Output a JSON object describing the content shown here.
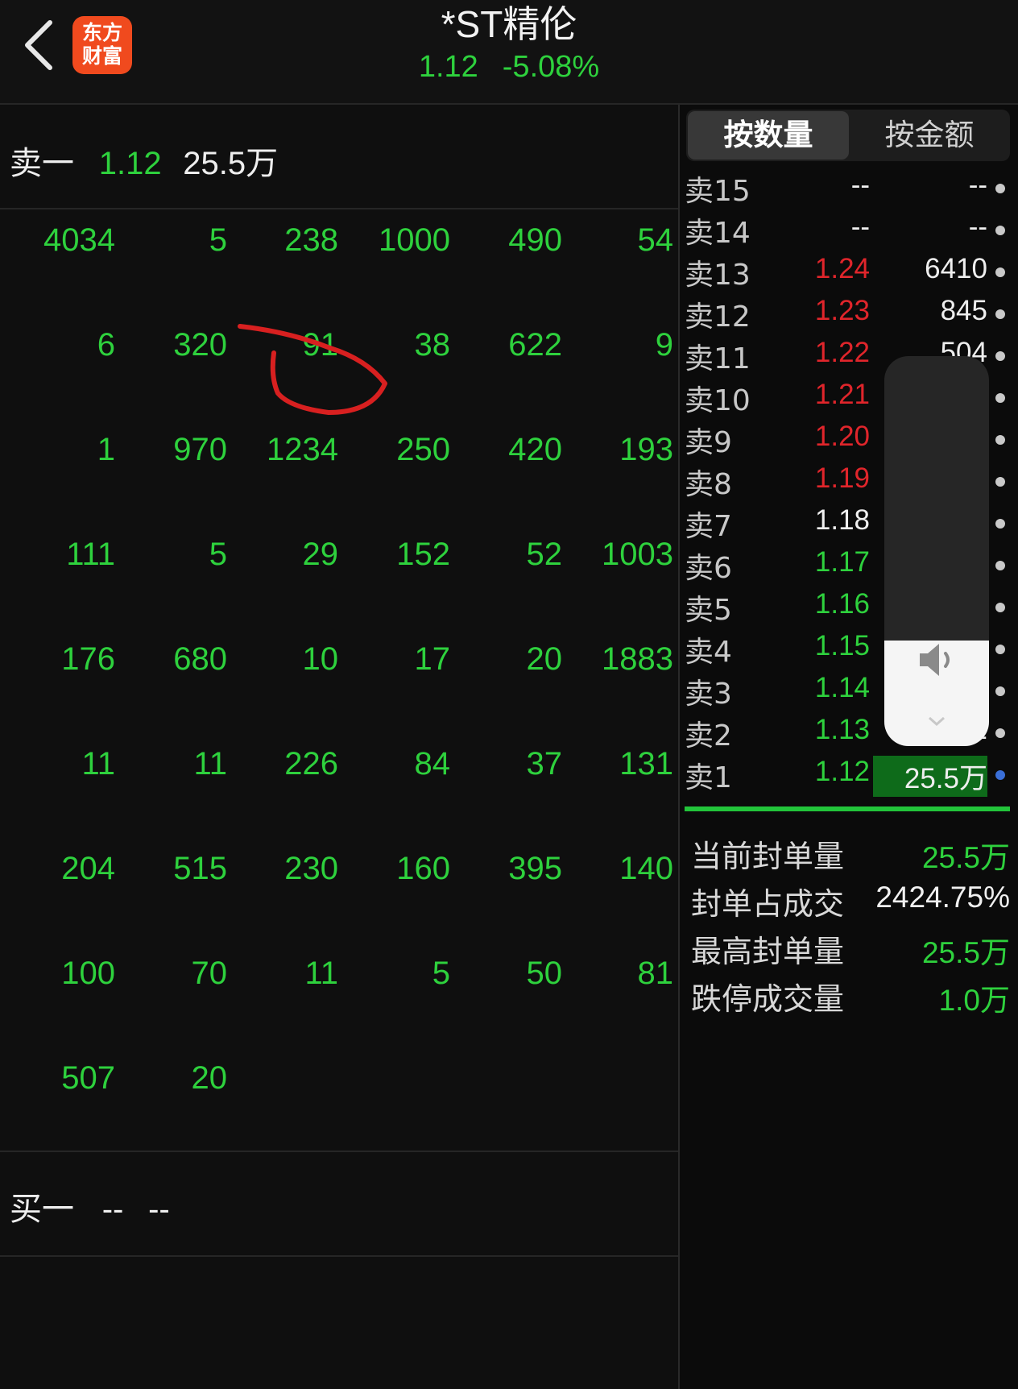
{
  "header": {
    "title": "*ST精伦",
    "price": "1.12",
    "change": "-5.08%",
    "logo_line1": "东方",
    "logo_line2": "财富",
    "back_icon": "chevron-left-icon"
  },
  "left": {
    "sell_label": "卖一",
    "sell_price": "1.12",
    "sell_volume": "25.5万",
    "buy_label": "买一",
    "buy_price": "--",
    "buy_volume": "--",
    "queue": [
      [
        "4034",
        "5",
        "238",
        "1000",
        "490",
        "54"
      ],
      [
        "6",
        "320",
        "91",
        "38",
        "622",
        "9"
      ],
      [
        "1",
        "970",
        "1234",
        "250",
        "420",
        "193"
      ],
      [
        "111",
        "5",
        "29",
        "152",
        "52",
        "1003"
      ],
      [
        "176",
        "680",
        "10",
        "17",
        "20",
        "1883"
      ],
      [
        "11",
        "11",
        "226",
        "84",
        "37",
        "131"
      ],
      [
        "204",
        "515",
        "230",
        "160",
        "395",
        "140"
      ],
      [
        "100",
        "70",
        "11",
        "5",
        "50",
        "81"
      ],
      [
        "507",
        "20"
      ]
    ]
  },
  "right": {
    "tabs": [
      "按数量",
      "按金额"
    ],
    "levels": [
      {
        "name": "卖15",
        "price": "--",
        "volume": "--",
        "color": "white"
      },
      {
        "name": "卖14",
        "price": "--",
        "volume": "--",
        "color": "white"
      },
      {
        "name": "卖13",
        "price": "1.24",
        "volume": "6410",
        "color": "red"
      },
      {
        "name": "卖12",
        "price": "1.23",
        "volume": "845",
        "color": "red"
      },
      {
        "name": "卖11",
        "price": "1.22",
        "volume": "504",
        "color": "red"
      },
      {
        "name": "卖10",
        "price": "1.21",
        "volume": "",
        "color": "red"
      },
      {
        "name": "卖9",
        "price": "1.20",
        "volume": "",
        "color": "red"
      },
      {
        "name": "卖8",
        "price": "1.19",
        "volume": "",
        "color": "red"
      },
      {
        "name": "卖7",
        "price": "1.18",
        "volume": "",
        "color": "white"
      },
      {
        "name": "卖6",
        "price": "1.17",
        "volume": "",
        "color": "green"
      },
      {
        "name": "卖5",
        "price": "1.16",
        "volume": "",
        "color": "green"
      },
      {
        "name": "卖4",
        "price": "1.15",
        "volume": "",
        "color": "green"
      },
      {
        "name": "卖3",
        "price": "1.14",
        "volume": "",
        "color": "green"
      },
      {
        "name": "卖2",
        "price": "1.13",
        "volume": "2",
        "color": "green"
      },
      {
        "name": "卖1",
        "price": "1.12",
        "volume": "25.5万",
        "color": "green"
      }
    ],
    "stats": [
      {
        "label": "当前封单量",
        "value": "25.5万",
        "color": "green"
      },
      {
        "label": "封单占成交",
        "value": "2424.75%",
        "color": "white"
      },
      {
        "label": "最高封单量",
        "value": "25.5万",
        "color": "green"
      },
      {
        "label": "跌停成交量",
        "value": "1.0万",
        "color": "green"
      }
    ]
  },
  "volume_overlay": {
    "level_fraction": 0.27,
    "icon": "speaker-icon"
  },
  "colors": {
    "green": "#2ed13d",
    "red": "#e0252b",
    "annotation": "#d82020"
  }
}
